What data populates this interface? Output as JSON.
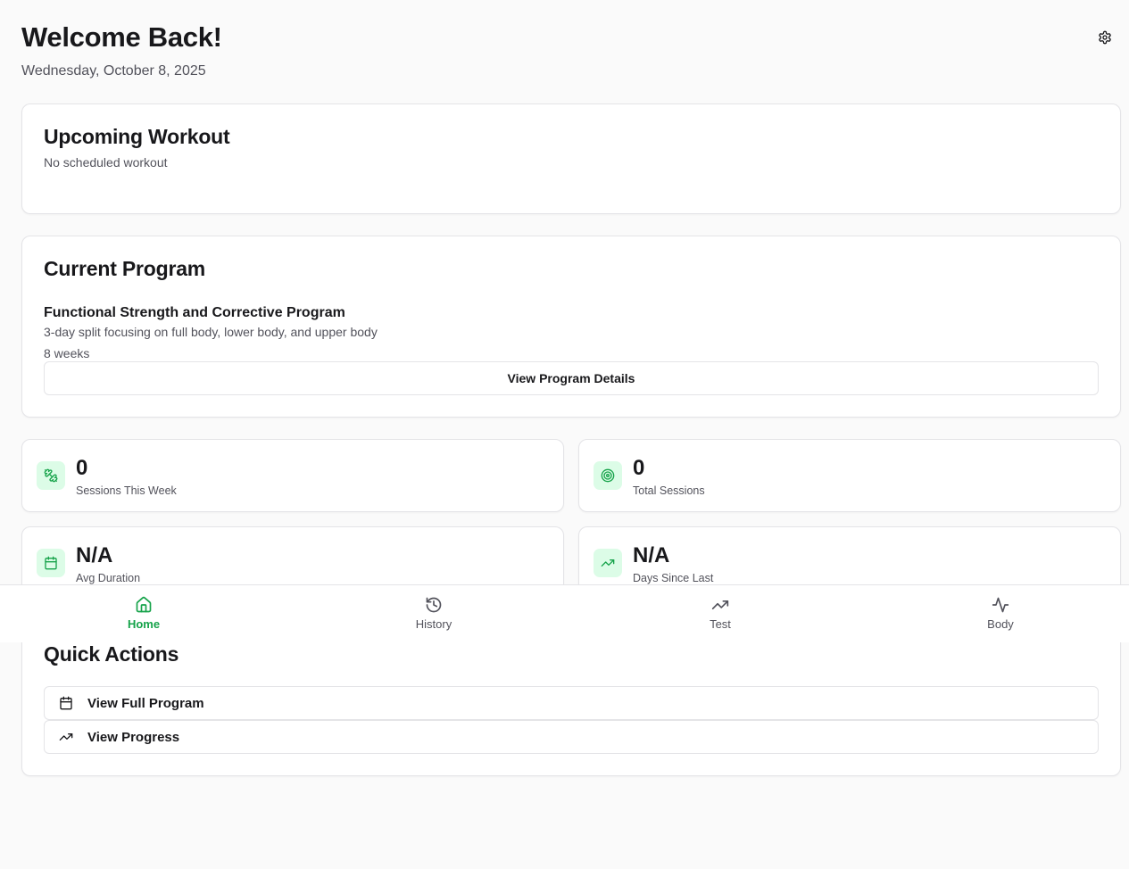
{
  "header": {
    "title": "Welcome Back!",
    "date": "Wednesday, October 8, 2025"
  },
  "upcoming": {
    "title": "Upcoming Workout",
    "subtitle": "No scheduled workout"
  },
  "program": {
    "title": "Current Program",
    "name": "Functional Strength and Corrective Program",
    "description": "3-day split focusing on full body, lower body, and upper body",
    "duration": "8 weeks",
    "button_label": "View Program Details"
  },
  "stats": [
    {
      "value": "0",
      "label": "Sessions This Week",
      "icon": "dumbbell-icon"
    },
    {
      "value": "0",
      "label": "Total Sessions",
      "icon": "target-icon"
    },
    {
      "value": "N/A",
      "label": "Avg Duration",
      "icon": "calendar-icon"
    },
    {
      "value": "N/A",
      "label": "Days Since Last",
      "icon": "trending-up-icon"
    }
  ],
  "quick_actions": {
    "title": "Quick Actions",
    "items": [
      {
        "label": "View Full Program",
        "icon": "calendar-icon"
      },
      {
        "label": "View Progress",
        "icon": "trending-up-icon"
      }
    ]
  },
  "nav": {
    "active": "Home",
    "items": [
      {
        "label": "Home",
        "icon": "home-icon"
      },
      {
        "label": "History",
        "icon": "history-icon"
      },
      {
        "label": "Test",
        "icon": "trending-up-icon"
      },
      {
        "label": "Body",
        "icon": "activity-icon"
      }
    ]
  },
  "colors": {
    "accent": "#16a34a",
    "accent_bg": "#dcfce7",
    "background": "#fafafa",
    "border": "#e4e4e7",
    "muted_text": "#52525b"
  }
}
